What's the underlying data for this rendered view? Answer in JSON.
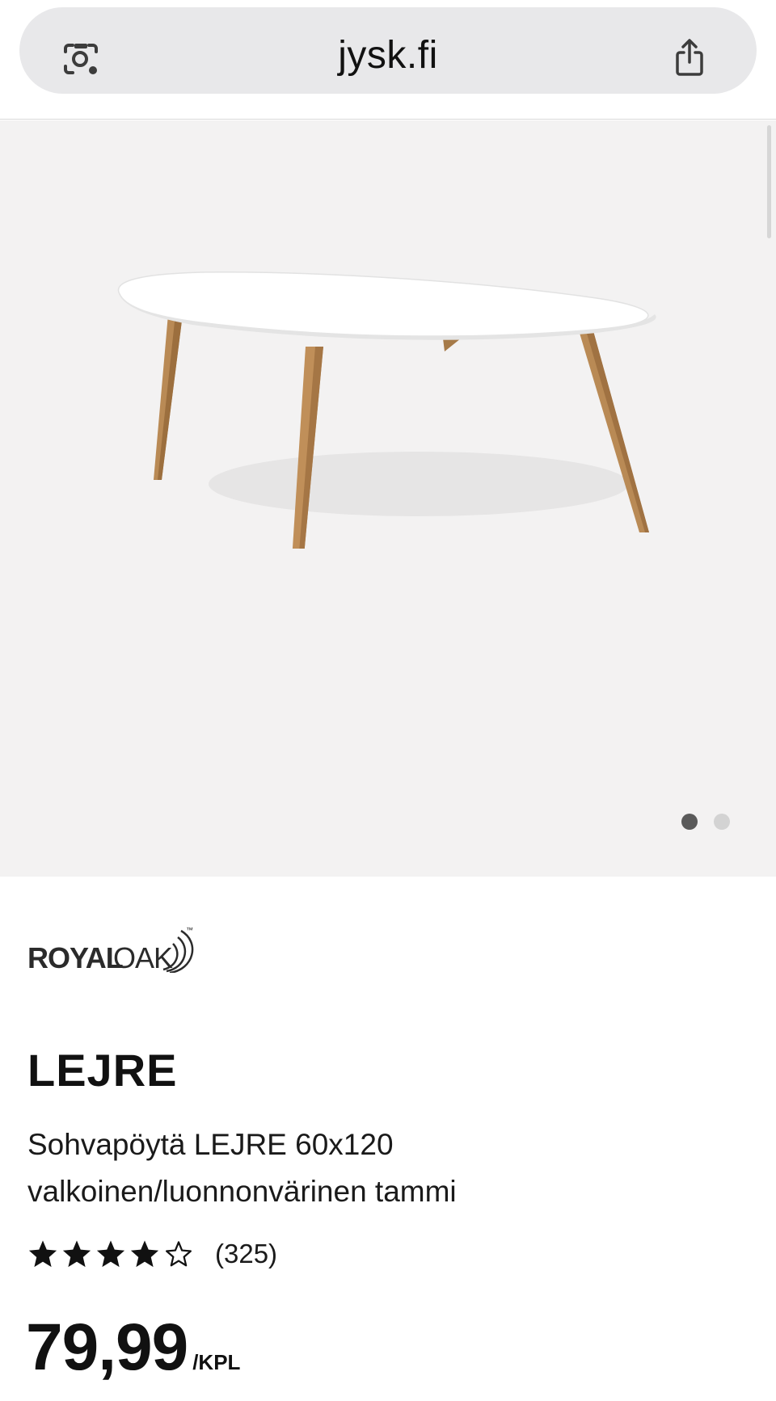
{
  "browser": {
    "url": "jysk.fi",
    "lens_icon": "camera-search-icon",
    "share_icon": "share-icon"
  },
  "gallery": {
    "image_count": 2,
    "active_index": 0,
    "image_alt": "Sohvapöytä LEJRE 60x120 valkoinen/luonnonvärinen tammi"
  },
  "brand": {
    "logo_text_bold": "ROYAL",
    "logo_text_light": "OAK",
    "logo_tm": "™"
  },
  "product": {
    "name": "LEJRE",
    "description_line1": "Sohvapöytä LEJRE 60x120",
    "description_line2": "valkoinen/luonnonvärinen tammi",
    "rating_value": 4,
    "rating_max": 5,
    "review_count": "(325)",
    "price": "79,99",
    "price_unit": "/KPL"
  },
  "colors": {
    "gallery_bg": "#f3f2f2",
    "tabletop": "#ffffff",
    "wood": "#b98a55",
    "dot_active": "#5a5a5a",
    "dot_inactive": "#d3d3d3"
  }
}
